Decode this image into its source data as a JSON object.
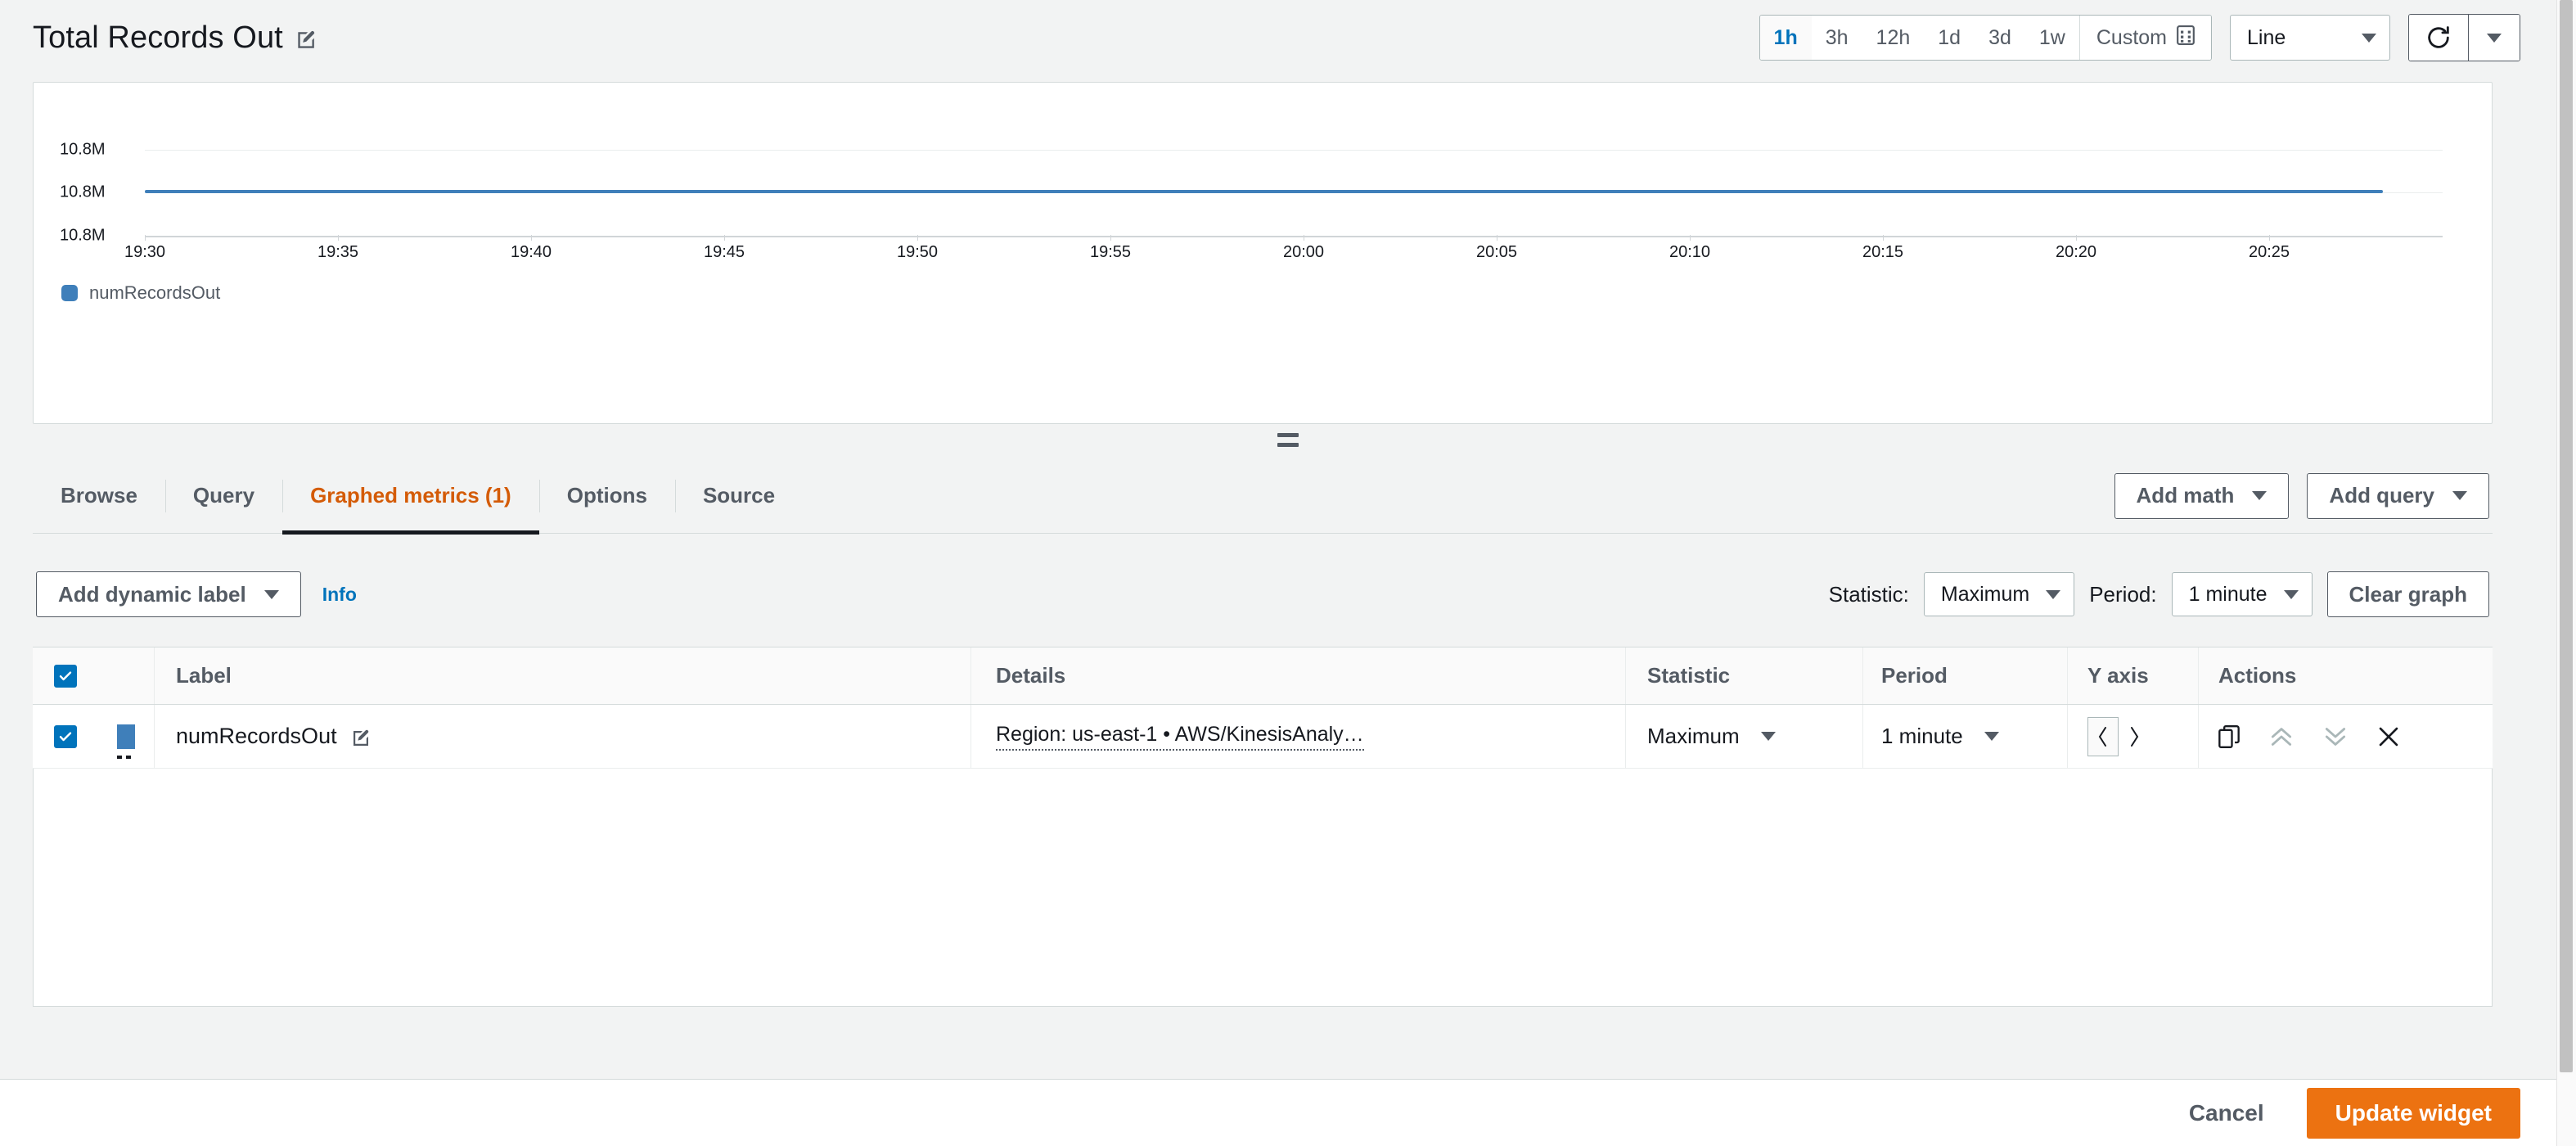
{
  "header": {
    "title": "Total Records Out",
    "edit_icon": "edit-pencil-icon",
    "time_ranges": [
      {
        "label": "1h",
        "active": true
      },
      {
        "label": "3h",
        "active": false
      },
      {
        "label": "12h",
        "active": false
      },
      {
        "label": "1d",
        "active": false
      },
      {
        "label": "3d",
        "active": false
      },
      {
        "label": "1w",
        "active": false
      }
    ],
    "custom_label": "Custom",
    "custom_icon": "calendar-icon",
    "chart_type": "Line",
    "refresh_icon": "refresh-icon",
    "refresh_caret_icon": "chevron-down-icon"
  },
  "chart_data": {
    "type": "line",
    "title": "Total Records Out",
    "xlabel": "",
    "ylabel": "",
    "grid": true,
    "legend_position": "bottom-left",
    "series": [
      {
        "name": "numRecordsOut",
        "color": "#3f7fba",
        "values": [
          10800000,
          10800000,
          10800000,
          10800000,
          10800000,
          10800000,
          10800000,
          10800000,
          10800000,
          10800000,
          10800000,
          10800000
        ]
      }
    ],
    "x": [
      "19:30",
      "19:35",
      "19:40",
      "19:45",
      "19:50",
      "19:55",
      "20:00",
      "20:05",
      "20:10",
      "20:15",
      "20:20",
      "20:25"
    ],
    "y_ticks": [
      "10.8M",
      "10.8M",
      "10.8M"
    ],
    "legend": [
      "numRecordsOut"
    ]
  },
  "tabs": [
    {
      "label": "Browse",
      "active": false
    },
    {
      "label": "Query",
      "active": false
    },
    {
      "label": "Graphed metrics (1)",
      "active": true
    },
    {
      "label": "Options",
      "active": false
    },
    {
      "label": "Source",
      "active": false
    }
  ],
  "tab_actions": {
    "add_math": "Add math",
    "add_query": "Add query"
  },
  "controls": {
    "add_dynamic_label": "Add dynamic label",
    "info": "Info",
    "statistic_label": "Statistic:",
    "statistic_value": "Maximum",
    "period_label": "Period:",
    "period_value": "1 minute",
    "clear_graph": "Clear graph"
  },
  "table": {
    "headers": [
      "Label",
      "Details",
      "Statistic",
      "Period",
      "Y axis",
      "Actions"
    ],
    "rows": [
      {
        "checked": true,
        "color": "#3f7fba",
        "label": "numRecordsOut",
        "details": "Region: us-east-1 • AWS/KinesisAnaly…",
        "statistic": "Maximum",
        "period": "1 minute",
        "y_axis": "left",
        "actions": [
          "duplicate-icon",
          "move-up-icon",
          "move-down-icon",
          "remove-icon"
        ]
      }
    ]
  },
  "footer": {
    "cancel": "Cancel",
    "update": "Update widget"
  },
  "colors": {
    "accent_orange": "#ec7211",
    "active_tab": "#d45b07",
    "link_blue": "#0073bb",
    "series_blue": "#3f7fba"
  }
}
